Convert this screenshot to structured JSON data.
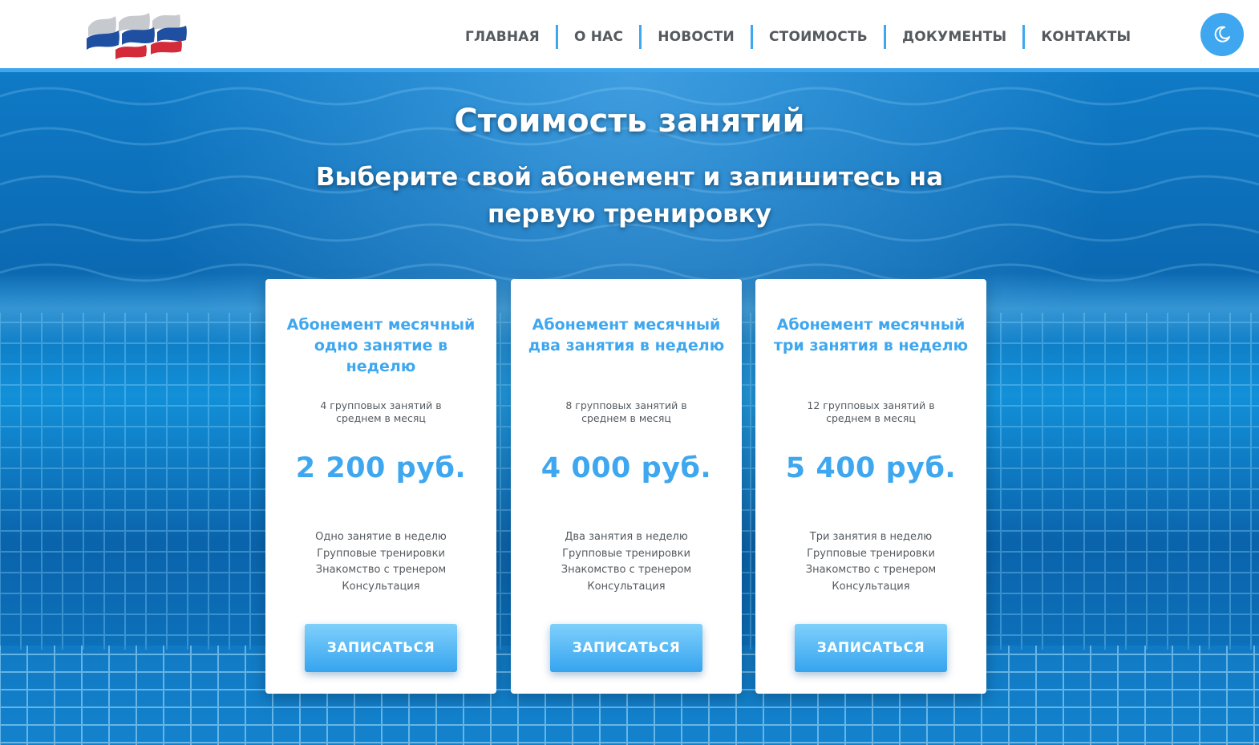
{
  "logo": {
    "icon": "wave-flag-logo",
    "colors": [
      "#c9cdd2",
      "#1f4fa0",
      "#d42b3a"
    ]
  },
  "nav": {
    "items": [
      {
        "label": "ГЛАВНАЯ"
      },
      {
        "label": "О НАС"
      },
      {
        "label": "НОВОСТИ"
      },
      {
        "label": "СТОИМОСТЬ"
      },
      {
        "label": "ДОКУМЕНТЫ"
      },
      {
        "label": "КОНТАКТЫ"
      }
    ],
    "theme_toggle_icon": "moon-icon"
  },
  "hero": {
    "title": "Стоимость занятий",
    "subtitle": "Выберите свой абонемент и запишитесь на первую тренировку"
  },
  "plans": [
    {
      "title": "Абонемент месячный одно занятие в неделю",
      "description": "4 групповых занятий в среднем в месяц",
      "price": "2 200 руб.",
      "features": [
        "Одно занятие в неделю",
        "Групповые тренировки",
        "Знакомство с тренером",
        "Консультация"
      ],
      "button": "ЗАПИСАТЬСЯ"
    },
    {
      "title": "Абонемент месячный два занятия в неделю",
      "description": "8 групповых занятий в среднем в месяц",
      "price": "4 000 руб.",
      "features": [
        "Два занятия в неделю",
        "Групповые тренировки",
        "Знакомство с тренером",
        "Консультация"
      ],
      "button": "ЗАПИСАТЬСЯ"
    },
    {
      "title": "Абонемент месячный три занятия в неделю",
      "description": "12 групповых занятий в среднем в месяц",
      "price": "5 400 руб.",
      "features": [
        "Три занятия в неделю",
        "Групповые тренировки",
        "Знакомство с тренером",
        "Консультация"
      ],
      "button": "ЗАПИСАТЬСЯ"
    }
  ],
  "colors": {
    "accent": "#3ea7ef",
    "nav_text": "#555a5f",
    "pool_blue": "#0b69b2"
  }
}
